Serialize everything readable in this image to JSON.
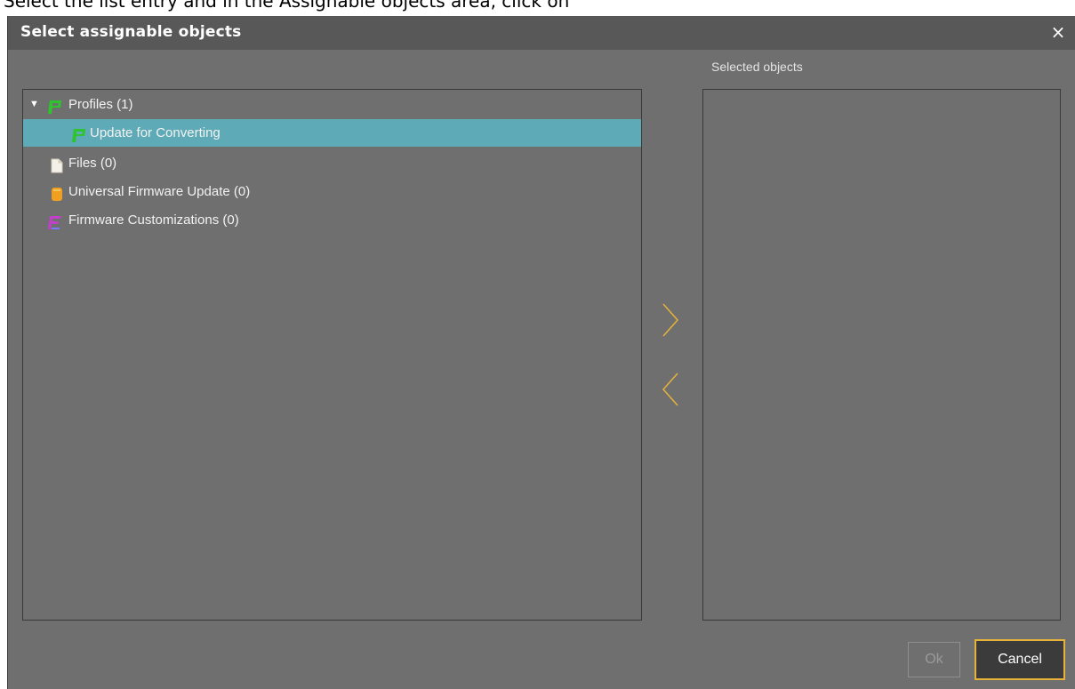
{
  "top_strip": {
    "text": "Select the list entry and in the Assignable objects area, click on"
  },
  "dialog": {
    "title": "Select assignable objects",
    "close_glyph": "×"
  },
  "selected_objects": {
    "label": "Selected objects"
  },
  "tree": {
    "items": [
      {
        "label": "Profiles (1)",
        "icon": "profile-icon",
        "expander": "▼"
      },
      {
        "label": "Update for Converting",
        "icon": "profile-icon"
      },
      {
        "label": "Files (0)",
        "icon": "file-icon"
      },
      {
        "label": "Universal Firmware Update (0)",
        "icon": "firmware-update-icon"
      },
      {
        "label": "Firmware Customizations (0)",
        "icon": "firmware-customization-icon"
      }
    ]
  },
  "buttons": {
    "ok": "Ok",
    "cancel": "Cancel"
  },
  "colors": {
    "dialog_bg": "#6f6f6f",
    "titlebar_bg": "#585858",
    "selection_bg": "#5eaab6",
    "accent": "#e6b23a",
    "profile_green": "#2ec42e",
    "firmware_orange": "#f0a020",
    "customization_magenta": "#c040c8"
  }
}
